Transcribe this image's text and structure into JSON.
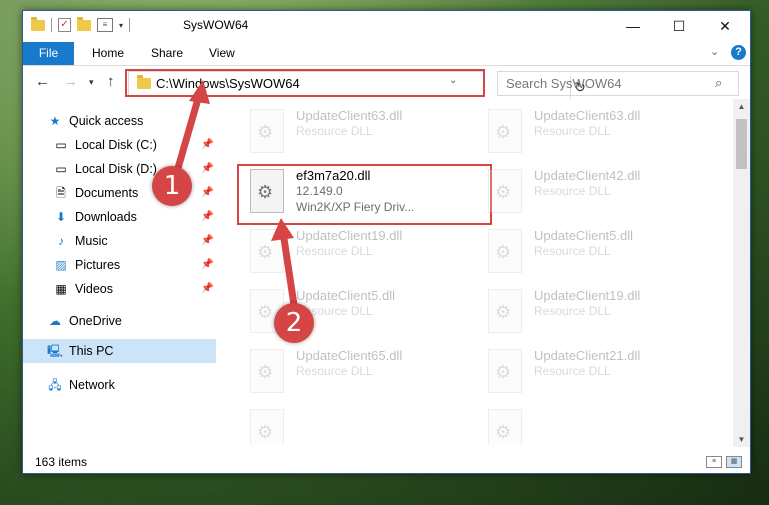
{
  "window": {
    "title": "SysWOW64",
    "minimize": "—",
    "maximize": "☐",
    "close": "✕"
  },
  "ribbon": {
    "tabs": [
      "File",
      "Home",
      "Share",
      "View"
    ],
    "expand_icon": "chevron-down-icon",
    "help": "?"
  },
  "address": {
    "path": "C:\\Windows\\SysWOW64",
    "search_placeholder": "Search SysWOW64"
  },
  "sidebar": {
    "items": [
      {
        "label": "Quick access",
        "icon": "star-icon",
        "pinned": false
      },
      {
        "label": "Local Disk (C:)",
        "icon": "drive-icon",
        "pinned": true
      },
      {
        "label": "Local Disk (D:)",
        "icon": "drive-icon",
        "pinned": true
      },
      {
        "label": "Documents",
        "icon": "documents-icon",
        "pinned": true
      },
      {
        "label": "Downloads",
        "icon": "download-icon",
        "pinned": true
      },
      {
        "label": "Music",
        "icon": "music-icon",
        "pinned": true
      },
      {
        "label": "Pictures",
        "icon": "pictures-icon",
        "pinned": true
      },
      {
        "label": "Videos",
        "icon": "videos-icon",
        "pinned": true
      },
      {
        "label": "OneDrive",
        "icon": "cloud-icon",
        "pinned": false
      },
      {
        "label": "This PC",
        "icon": "computer-icon",
        "pinned": false
      },
      {
        "label": "Network",
        "icon": "network-icon",
        "pinned": false
      }
    ]
  },
  "files": [
    {
      "name": "UpdateClient63.dll",
      "type": "Resource DLL",
      "faded": true
    },
    {
      "name": "UpdateClient63.dll",
      "type": "Resource DLL",
      "faded": true
    },
    {
      "name": "ef3m7a20.dll",
      "version": "12.149.0",
      "type": "Win2K/XP Fiery Driv...",
      "faded": false
    },
    {
      "name": "UpdateClient42.dll",
      "type": "Resource DLL",
      "faded": true
    },
    {
      "name": "UpdateClient19.dll",
      "type": "Resource DLL",
      "faded": true
    },
    {
      "name": "UpdateClient5.dll",
      "type": "Resource DLL",
      "faded": true
    },
    {
      "name": "UpdateClient5.dll",
      "type": "Resource DLL",
      "faded": true
    },
    {
      "name": "UpdateClient19.dll",
      "type": "Resource DLL",
      "faded": true
    },
    {
      "name": "UpdateClient65.dll",
      "type": "Resource DLL",
      "faded": true
    },
    {
      "name": "UpdateClient21.dll",
      "type": "Resource DLL",
      "faded": true
    }
  ],
  "status": {
    "count": "163 items"
  },
  "annotations": {
    "step1": "1",
    "step2": "2",
    "color": "#d64545"
  }
}
